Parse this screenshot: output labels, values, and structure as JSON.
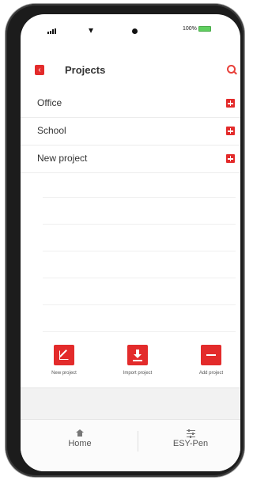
{
  "status_bar": {
    "battery_text": "100%"
  },
  "header": {
    "title": "Projects"
  },
  "projects": [
    {
      "name": "Office"
    },
    {
      "name": "School"
    },
    {
      "name": "New project"
    }
  ],
  "actions": {
    "new_project": "New project",
    "import_project": "Import project",
    "add_project": "Add project"
  },
  "nav": {
    "home": "Home",
    "esy_pen": "ESY-Pen"
  },
  "colors": {
    "accent": "#e32b2b",
    "battery": "#5fcf5f"
  },
  "icons": {
    "back": "back-arrow-icon",
    "search": "search-icon",
    "add": "plus-box-icon",
    "new": "edit-icon",
    "import": "download-icon",
    "remove": "minus-icon",
    "home": "home-icon",
    "pen": "sliders-icon"
  }
}
